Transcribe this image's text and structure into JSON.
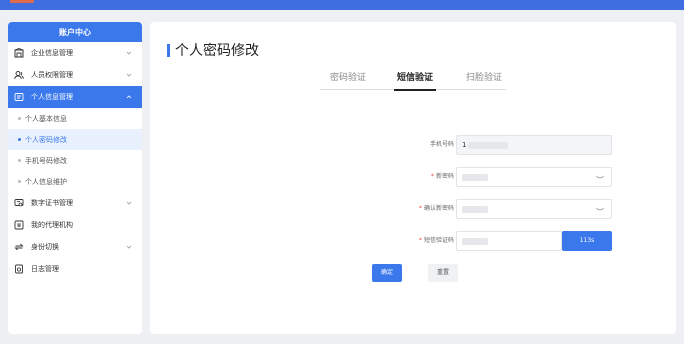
{
  "sidebar": {
    "title": "账户中心",
    "items": [
      {
        "label": "企业信息管理",
        "icon": "building-icon"
      },
      {
        "label": "人员权限管理",
        "icon": "user-group-icon"
      },
      {
        "label": "个人信息管理",
        "icon": "profile-card-icon"
      },
      {
        "label": "数字证书管理",
        "icon": "certificate-icon"
      },
      {
        "label": "我的代理机构",
        "icon": "agency-icon"
      },
      {
        "label": "身份切换",
        "icon": "switch-icon"
      },
      {
        "label": "日志管理",
        "icon": "log-icon"
      }
    ],
    "subitems": [
      {
        "label": "个人基本信息"
      },
      {
        "label": "个人密码修改"
      },
      {
        "label": "手机号码修改"
      },
      {
        "label": "个人信息维护"
      }
    ]
  },
  "main": {
    "title": "个人密码修改",
    "tabs": [
      "密码验证",
      "短信验证",
      "扫脸验证"
    ],
    "form": {
      "phone_label": "手机号码",
      "phone_value": "1",
      "new_password_label": "新密码",
      "confirm_password_label": "确认新密码",
      "sms_code_label": "短信验证码",
      "sms_code_value": "",
      "countdown_label": "113s",
      "required_mark": "*"
    },
    "buttons": {
      "confirm": "确定",
      "reset": "重置"
    }
  },
  "colors": {
    "accent": "#3a78ec",
    "topbar": "#3f6ee0",
    "background": "#eef0f4"
  }
}
